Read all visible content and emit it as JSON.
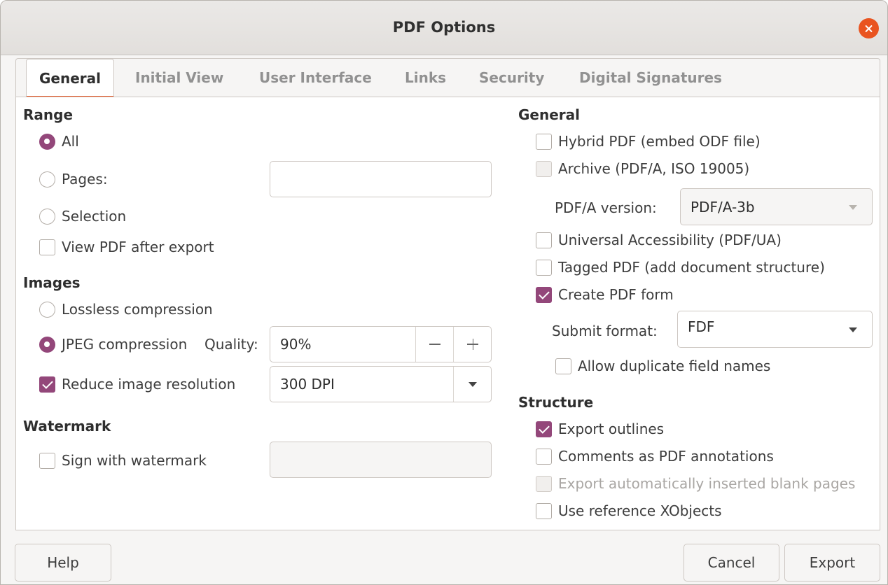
{
  "window": {
    "title": "PDF Options"
  },
  "tabs": [
    "General",
    "Initial View",
    "User Interface",
    "Links",
    "Security",
    "Digital Signatures"
  ],
  "range": {
    "heading": "Range",
    "all": "All",
    "pages": "Pages:",
    "pages_value": "",
    "selection": "Selection",
    "view_after": "View PDF after export"
  },
  "images": {
    "heading": "Images",
    "lossless": "Lossless compression",
    "jpeg": "JPEG compression",
    "quality_label": "Quality:",
    "quality_value": "90%",
    "reduce": "Reduce image resolution",
    "resolution_value": "300 DPI"
  },
  "watermark": {
    "heading": "Watermark",
    "sign": "Sign with watermark",
    "text_value": ""
  },
  "general": {
    "heading": "General",
    "hybrid": "Hybrid PDF (embed ODF file)",
    "archive": "Archive (PDF/A, ISO 19005)",
    "pdfa_label": "PDF/A version:",
    "pdfa_value": "PDF/A-3b",
    "ua": "Universal Accessibility (PDF/UA)",
    "tagged": "Tagged PDF (add document structure)",
    "form": "Create PDF form",
    "submit_label": "Submit format:",
    "submit_value": "FDF",
    "duplicate": "Allow duplicate field names"
  },
  "structure": {
    "heading": "Structure",
    "outlines": "Export outlines",
    "comments": "Comments as PDF annotations",
    "blank": "Export automatically inserted blank pages",
    "xobjects": "Use reference XObjects"
  },
  "buttons": {
    "help": "Help",
    "cancel": "Cancel",
    "export": "Export"
  },
  "colors": {
    "accent": "#e95420",
    "check": "#93477a"
  }
}
